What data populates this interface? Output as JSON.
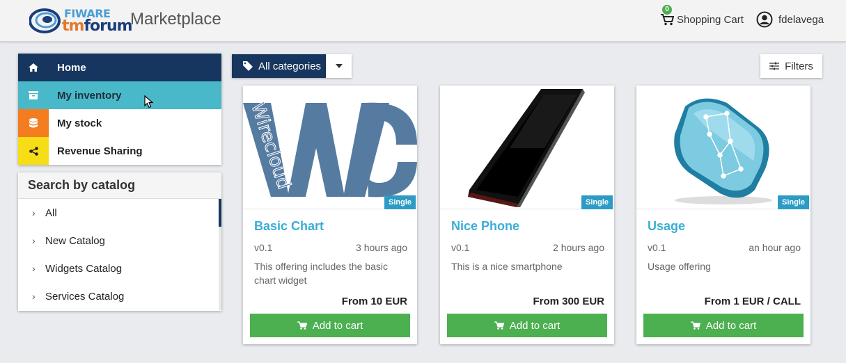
{
  "header": {
    "logo_top": "FIWARE",
    "logo_tm": "tm",
    "logo_forum": "forum",
    "app_title": "Marketplace",
    "cart_label": "Shopping Cart",
    "cart_count": "0",
    "username": "fdelavega"
  },
  "nav": {
    "items": [
      {
        "label": "Home",
        "icon": "home-icon"
      },
      {
        "label": "My inventory",
        "icon": "archive-icon"
      },
      {
        "label": "My stock",
        "icon": "database-icon"
      },
      {
        "label": "Revenue Sharing",
        "icon": "share-icon"
      }
    ]
  },
  "catalog": {
    "title": "Search by catalog",
    "items": [
      "All",
      "New Catalog",
      "Widgets Catalog",
      "Services Catalog"
    ]
  },
  "toolbar": {
    "category_label": "All categories",
    "filters_label": "Filters"
  },
  "offerings": [
    {
      "title": "Basic Chart",
      "badge": "Single",
      "version": "v0.1",
      "time": "3 hours ago",
      "description": "This offering includes the basic chart widget",
      "price": "From 10 EUR",
      "button": "Add to cart",
      "image_text": "Wirecloud"
    },
    {
      "title": "Nice Phone",
      "badge": "Single",
      "version": "v0.1",
      "time": "2 hours ago",
      "description": "This is a nice smartphone",
      "price": "From 300 EUR",
      "button": "Add to cart"
    },
    {
      "title": "Usage",
      "badge": "Single",
      "version": "v0.1",
      "time": "an hour ago",
      "description": "Usage offering",
      "price": "From 1 EUR / CALL",
      "button": "Add to cart"
    }
  ],
  "colors": {
    "primary": "#17365f",
    "accent": "#49b8c9",
    "stock": "#f47d20",
    "revenue": "#f7dd16",
    "success": "#4caf50",
    "title": "#3aaed4"
  }
}
